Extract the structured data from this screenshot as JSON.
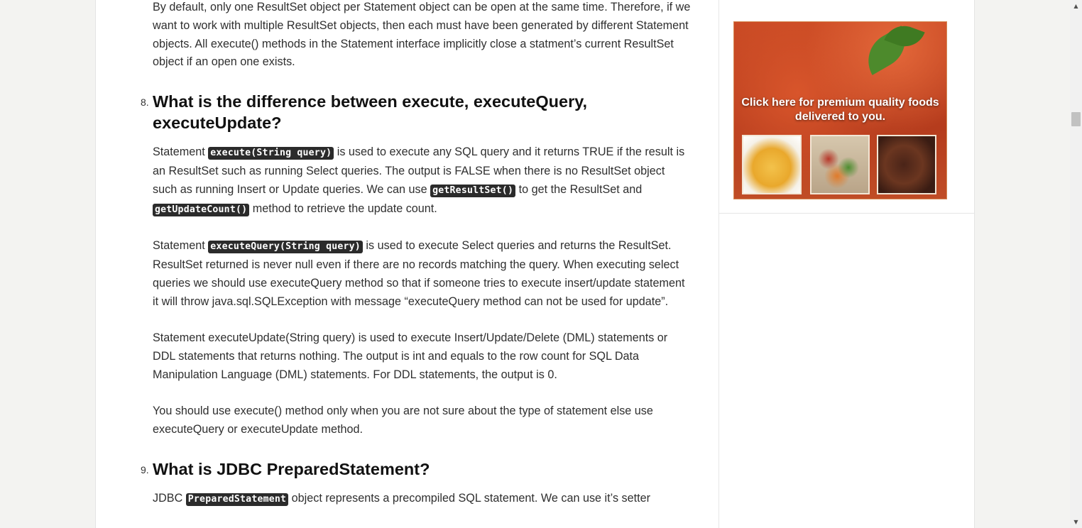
{
  "article": {
    "intro_paragraph": "By default, only one ResultSet object per Statement object can be open at the same time. Therefore, if we want to work with multiple ResultSet objects, then each must have been generated by different Statement objects. All execute() methods in the Statement interface implicitly close a statment’s current ResultSet object if an open one exists.",
    "q8": {
      "number": "8.",
      "title": "What is the difference between execute, executeQuery, executeUpdate?",
      "p1": {
        "t1": "Statement ",
        "c1": "execute(String query)",
        "t2": " is used to execute any SQL query and it returns TRUE if the result is an ResultSet such as running Select queries. The output is FALSE when there is no ResultSet object such as running Insert or Update queries. We can use ",
        "c2": "getResultSet()",
        "t3": " to get the ResultSet and ",
        "c3": "getUpdateCount()",
        "t4": " method to retrieve the update count."
      },
      "p2": {
        "t1": "Statement ",
        "c1": "executeQuery(String query)",
        "t2": " is used to execute Select queries and returns the ResultSet. ResultSet returned is never null even if there are no records matching the query. When executing select queries we should use executeQuery method so that if someone tries to execute insert/update statement it will throw java.sql.SQLException with message “executeQuery method can not be used for update”."
      },
      "p3": "Statement executeUpdate(String query) is used to execute Insert/Update/Delete (DML) statements or DDL statements that returns nothing. The output is int and equals to the row count for SQL Data Manipulation Language (DML) statements. For DDL statements, the output is 0.",
      "p4": "You should use execute() method only when you are not sure about the type of statement else use executeQuery or executeUpdate method."
    },
    "q9": {
      "number": "9.",
      "title": "What is JDBC PreparedStatement?",
      "p1": {
        "t1": "JDBC ",
        "c1": "PreparedStatement",
        "t2": " object represents a precompiled SQL statement. We can use it’s setter"
      }
    }
  },
  "sidebar": {
    "ad": {
      "text": "Click here for premium quality foods delivered to you."
    }
  },
  "scrollbar": {
    "up_arrow": "▲",
    "down_arrow": "▼"
  }
}
